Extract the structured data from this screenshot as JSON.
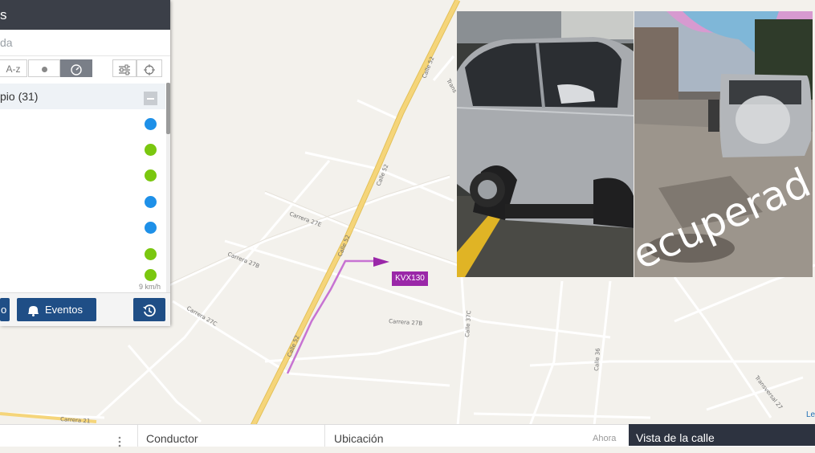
{
  "panel": {
    "title_fragment": "s",
    "search_placeholder_fragment": "da",
    "toolbar": {
      "sort_az": "A-z",
      "status_dot_icon": "dot-icon",
      "speed_icon": "gauge-icon",
      "filter_icon": "sliders-icon",
      "locate_icon": "crosshair-icon"
    },
    "group": {
      "label": "pio (31)"
    },
    "status_dots": [
      "#1e90e8",
      "#7ac70f",
      "#7ac70f",
      "#1e90e8",
      "#1e90e8",
      "#7ac70f",
      "#7ac70f"
    ],
    "speed_text": "9 km/h",
    "footer": {
      "left_button_fragment": "o",
      "events_label": "Eventos",
      "history_icon": "history-icon"
    }
  },
  "map": {
    "streets": {
      "calle_52": "Calle 52",
      "calle_52_b": "Calle 52",
      "carrera_27e": "Carrera 27E",
      "carrera_27b": "Carrera 27B",
      "carrera_27c": "Carrera 27C",
      "carrera_27b_2": "Carrera 27B",
      "calle_37c": "Calle 37C",
      "calle_36": "Calle 36",
      "transversal_27": "Transversal 27",
      "carrera_21": "Carrera 21",
      "trans": "Trans"
    },
    "vehicle_tag": "KVX130",
    "attribution": "Le"
  },
  "photos": {
    "right_overlay_text": "ecuperad"
  },
  "bottom_bar": {
    "col_driver": "Conductor",
    "col_location": "Ubicación",
    "col_time": "Ahora",
    "street_view": "Vista de la calle",
    "menu_icon": "kebab-icon"
  },
  "colors": {
    "primary_button": "#1f4e86",
    "vehicle_marker": "#9a27a8",
    "main_road": "#f5d57a",
    "header_bg": "#3b3f48"
  }
}
